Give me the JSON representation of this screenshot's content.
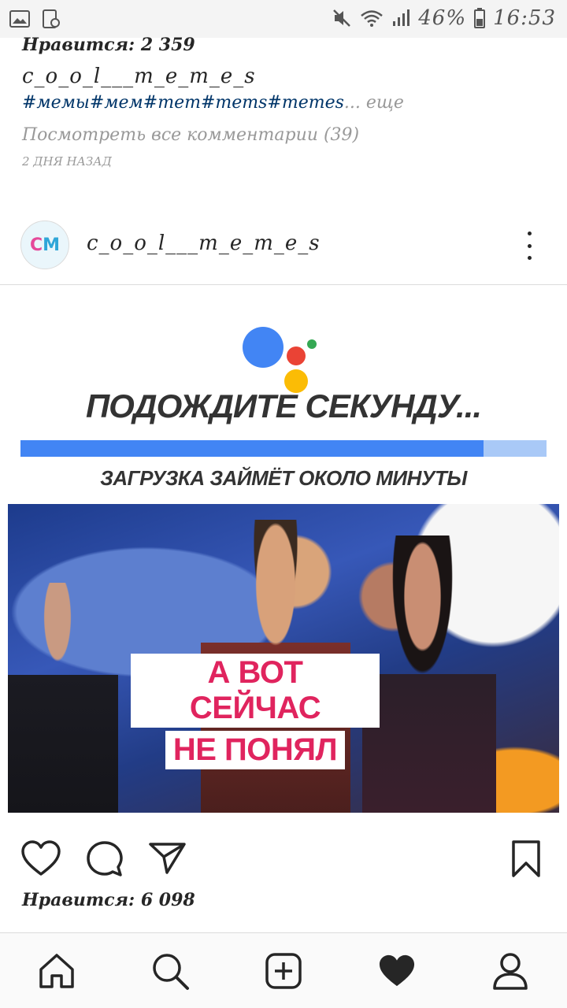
{
  "status_bar": {
    "battery": "46%",
    "time": "16:53"
  },
  "prev_post": {
    "likes": "Нравится: 2 359",
    "username": "c_o_o_l___m_e_m_e_s",
    "hashtags": "#мемы#мем#mem#mems#memes",
    "more_label": "... еще",
    "view_comments": "Посмотреть все комментарии (39)",
    "time_ago": "2 ДНЯ НАЗАД"
  },
  "post": {
    "avatar_text_c": "C",
    "avatar_text_m": "M",
    "username": "c_o_o_l___m_e_m_e_s",
    "image": {
      "headline": "ПОДОЖДИТЕ СЕКУНДУ...",
      "subline": "ЗАГРУЗКА ЗАЙМЁТ ОКОЛО МИНУТЫ",
      "progress": 0.88,
      "caption_line1": "А ВОТ СЕЙЧАС",
      "caption_line2": "НЕ ПОНЯЛ",
      "colors": {
        "blue": "#4285f4",
        "red": "#ea4335",
        "yellow": "#fbbc05",
        "green": "#34a853",
        "caption": "#e0245e"
      }
    },
    "likes": "Нравится: 6 098"
  },
  "actions": [
    "heart-icon",
    "comment-icon",
    "share-icon",
    "bookmark-icon"
  ],
  "nav": [
    "home-icon",
    "search-icon",
    "add-post-icon",
    "activity-heart-icon",
    "profile-icon"
  ]
}
